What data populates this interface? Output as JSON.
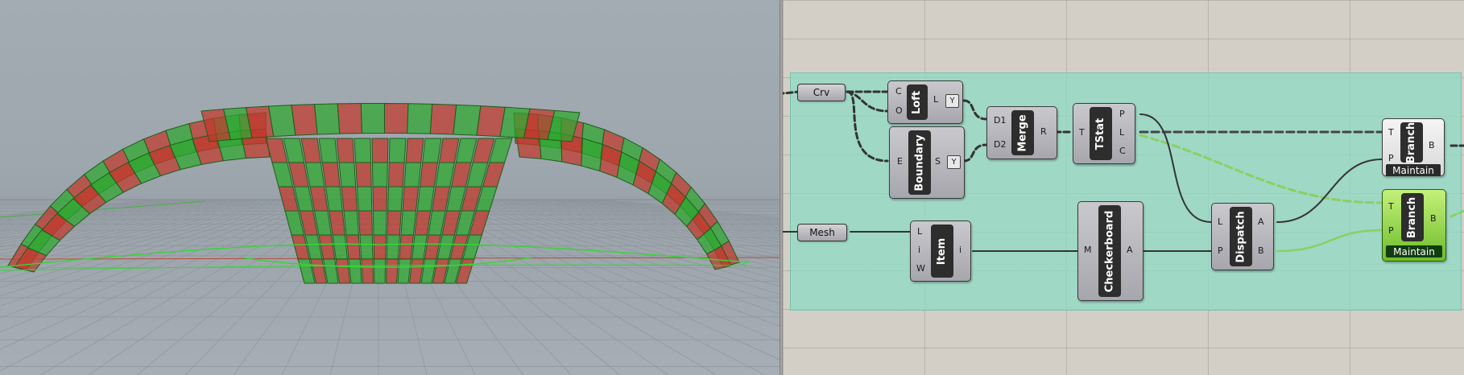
{
  "viewport": {
    "colors": {
      "red_panel": "#c0392b",
      "green_panel": "#2ea82e",
      "edge": "#1c5e1c"
    }
  },
  "canvas": {
    "group_color": "#91dac4",
    "selected_color": "#8bd63e",
    "params": {
      "crv": "Crv",
      "mesh": "Mesh"
    },
    "components": {
      "loft": {
        "name": "Loft",
        "inputs": [
          "C",
          "O"
        ],
        "outputs": [
          "L"
        ]
      },
      "boundary": {
        "name": "Boundary",
        "inputs": [
          "E"
        ],
        "outputs": [
          "S"
        ]
      },
      "merge": {
        "name": "Merge",
        "inputs": [
          "D1",
          "D2"
        ],
        "outputs": [
          "R"
        ]
      },
      "tstat": {
        "name": "TStat",
        "inputs": [
          "T"
        ],
        "outputs": [
          "P",
          "L",
          "C"
        ]
      },
      "item": {
        "name": "Item",
        "inputs": [
          "L",
          "i",
          "W"
        ],
        "outputs": [
          "i"
        ]
      },
      "checkerboard": {
        "name": "Checkerboard",
        "inputs": [
          "M"
        ],
        "outputs": [
          "A"
        ]
      },
      "dispatch": {
        "name": "Dispatch",
        "inputs": [
          "L",
          "P"
        ],
        "outputs": [
          "A",
          "B"
        ]
      },
      "branch1": {
        "name": "Branch",
        "inputs": [
          "T",
          "P"
        ],
        "outputs": [
          "B"
        ],
        "tag": "Maintain"
      },
      "branch2": {
        "name": "Branch",
        "inputs": [
          "T",
          "P"
        ],
        "outputs": [
          "B"
        ],
        "tag": "Maintain"
      }
    },
    "flag_glyph": "Y"
  }
}
